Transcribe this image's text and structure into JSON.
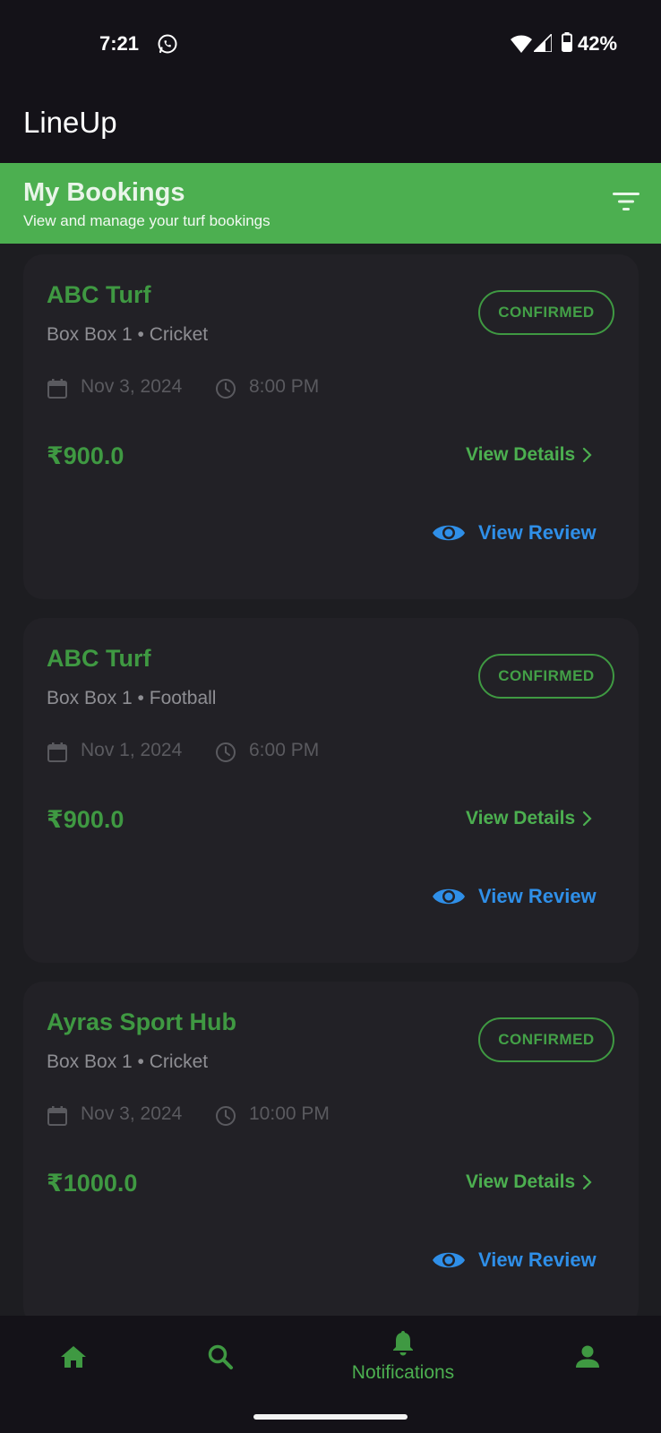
{
  "status_bar": {
    "time": "7:21",
    "battery": "42%"
  },
  "app": {
    "title": "LineUp"
  },
  "header": {
    "title": "My Bookings",
    "subtitle": "View and manage your turf bookings"
  },
  "bookings": [
    {
      "turf": "ABC Turf",
      "detail": "Box Box 1 • Cricket",
      "status": "CONFIRMED",
      "date": "Nov 3, 2024",
      "time": "8:00 PM",
      "price": "₹900.0",
      "details_label": "View Details",
      "review_label": "View Review"
    },
    {
      "turf": "ABC Turf",
      "detail": "Box Box 1 • Football",
      "status": "CONFIRMED",
      "date": "Nov 1, 2024",
      "time": "6:00 PM",
      "price": "₹900.0",
      "details_label": "View Details",
      "review_label": "View Review"
    },
    {
      "turf": "Ayras Sport Hub",
      "detail": "Box Box 1 • Cricket",
      "status": "CONFIRMED",
      "date": "Nov 3, 2024",
      "time": "10:00 PM",
      "price": "₹1000.0",
      "details_label": "View Details",
      "review_label": "View Review"
    }
  ],
  "bottom_nav": {
    "items": [
      {
        "icon": "home-icon"
      },
      {
        "icon": "search-icon"
      },
      {
        "icon": "bell-icon",
        "label": "Notifications",
        "active": true
      },
      {
        "icon": "person-icon"
      }
    ]
  },
  "colors": {
    "accent": "#4caf50",
    "link_blue": "#2f8fe8",
    "background": "#1b1b1f",
    "card": "#222126"
  }
}
